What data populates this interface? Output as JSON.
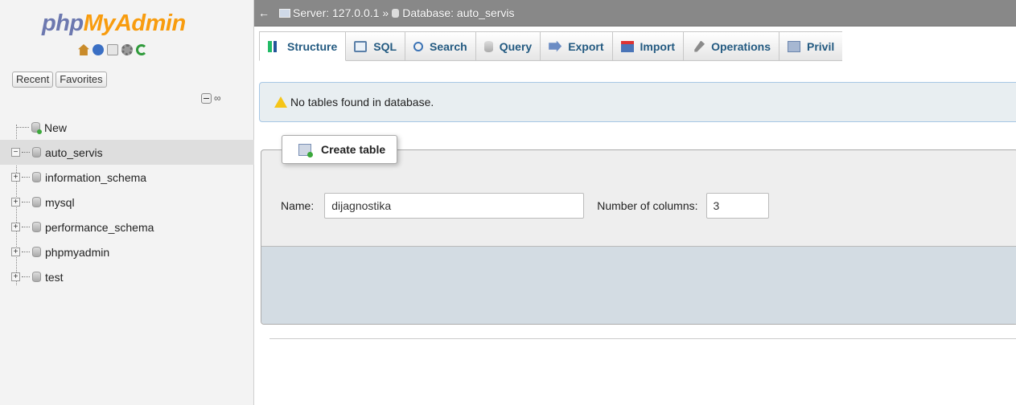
{
  "nav": {
    "logo": {
      "part1": "php",
      "part2": "MyAdmin"
    },
    "quick_icons": [
      "home-icon",
      "exit-icon",
      "docs-icon",
      "settings-icon",
      "reload-icon"
    ],
    "tabs": {
      "recent": "Recent",
      "favorites": "Favorites"
    },
    "tree": [
      {
        "label": "New",
        "type": "new"
      },
      {
        "label": "auto_servis",
        "type": "db",
        "expanded": true,
        "active": true
      },
      {
        "label": "information_schema",
        "type": "db"
      },
      {
        "label": "mysql",
        "type": "db"
      },
      {
        "label": "performance_schema",
        "type": "db"
      },
      {
        "label": "phpmyadmin",
        "type": "db"
      },
      {
        "label": "test",
        "type": "db"
      }
    ]
  },
  "breadcrumb": {
    "back_arrow": "←",
    "server": "Server: 127.0.0.1",
    "separator": "»",
    "database": "Database: auto_servis"
  },
  "tabs": [
    {
      "label": "Structure",
      "icon": "structure",
      "active": true
    },
    {
      "label": "SQL",
      "icon": "sql"
    },
    {
      "label": "Search",
      "icon": "search"
    },
    {
      "label": "Query",
      "icon": "query"
    },
    {
      "label": "Export",
      "icon": "export"
    },
    {
      "label": "Import",
      "icon": "import"
    },
    {
      "label": "Operations",
      "icon": "operations"
    },
    {
      "label": "Privil",
      "icon": "privileges"
    }
  ],
  "notice": {
    "text": "No tables found in database."
  },
  "create_table": {
    "legend": "Create table",
    "name_label": "Name:",
    "name_value": "dijagnostika",
    "columns_label": "Number of columns:",
    "columns_value": "3"
  },
  "colors": {
    "logo_blue": "#6c78af",
    "logo_orange": "#f89c0e",
    "tab_text": "#235a81",
    "topbar_bg": "#888888",
    "notice_bg": "#e8eef1",
    "footer_bg": "#d3dce3"
  }
}
